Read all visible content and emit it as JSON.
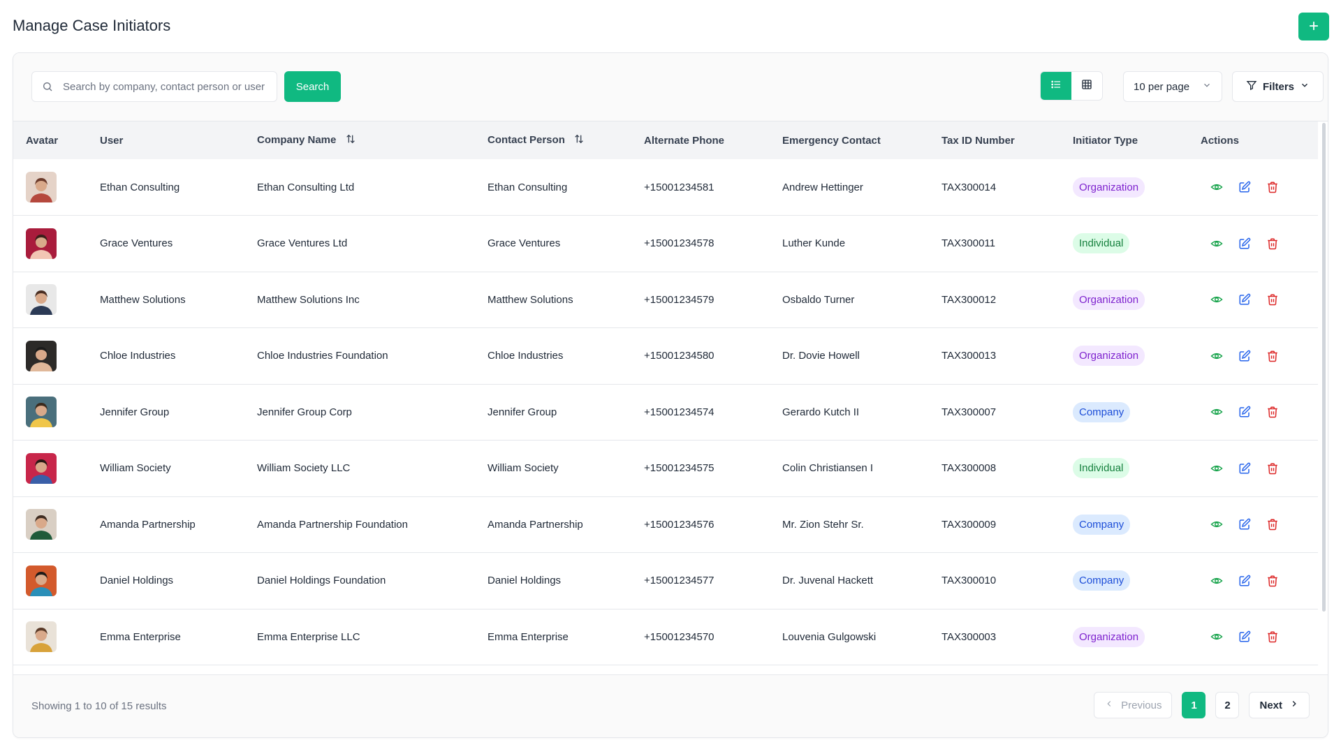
{
  "page": {
    "title": "Manage Case Initiators",
    "add_label": "+"
  },
  "toolbar": {
    "search_placeholder": "Search by company, contact person or user",
    "search_label": "Search",
    "per_page": "10 per page",
    "filters_label": "Filters"
  },
  "table": {
    "headers": {
      "avatar": "Avatar",
      "user": "User",
      "company": "Company Name",
      "contact": "Contact Person",
      "phone": "Alternate Phone",
      "emergency": "Emergency Contact",
      "tax": "Tax ID Number",
      "type": "Initiator Type",
      "actions": "Actions"
    },
    "rows": [
      {
        "user": "Ethan Consulting",
        "company": "Ethan Consulting Ltd",
        "contact": "Ethan Consulting",
        "phone": "+15001234581",
        "emergency": "Andrew Hettinger",
        "tax": "TAX300014",
        "type": "Organization"
      },
      {
        "user": "Grace Ventures",
        "company": "Grace Ventures Ltd",
        "contact": "Grace Ventures",
        "phone": "+15001234578",
        "emergency": "Luther Kunde",
        "tax": "TAX300011",
        "type": "Individual"
      },
      {
        "user": "Matthew Solutions",
        "company": "Matthew Solutions Inc",
        "contact": "Matthew Solutions",
        "phone": "+15001234579",
        "emergency": "Osbaldo Turner",
        "tax": "TAX300012",
        "type": "Organization"
      },
      {
        "user": "Chloe Industries",
        "company": "Chloe Industries Foundation",
        "contact": "Chloe Industries",
        "phone": "+15001234580",
        "emergency": "Dr. Dovie Howell",
        "tax": "TAX300013",
        "type": "Organization"
      },
      {
        "user": "Jennifer Group",
        "company": "Jennifer Group Corp",
        "contact": "Jennifer Group",
        "phone": "+15001234574",
        "emergency": "Gerardo Kutch II",
        "tax": "TAX300007",
        "type": "Company"
      },
      {
        "user": "William Society",
        "company": "William Society LLC",
        "contact": "William Society",
        "phone": "+15001234575",
        "emergency": "Colin Christiansen I",
        "tax": "TAX300008",
        "type": "Individual"
      },
      {
        "user": "Amanda Partnership",
        "company": "Amanda Partnership Foundation",
        "contact": "Amanda Partnership",
        "phone": "+15001234576",
        "emergency": "Mr. Zion Stehr Sr.",
        "tax": "TAX300009",
        "type": "Company"
      },
      {
        "user": "Daniel Holdings",
        "company": "Daniel Holdings Foundation",
        "contact": "Daniel Holdings",
        "phone": "+15001234577",
        "emergency": "Dr. Juvenal Hackett",
        "tax": "TAX300010",
        "type": "Company"
      },
      {
        "user": "Emma Enterprise",
        "company": "Emma Enterprise LLC",
        "contact": "Emma Enterprise",
        "phone": "+15001234570",
        "emergency": "Louvenia Gulgowski",
        "tax": "TAX300003",
        "type": "Organization"
      }
    ]
  },
  "footer": {
    "results": "Showing 1 to 10 of 15 results",
    "previous": "Previous",
    "next": "Next",
    "pages": [
      "1",
      "2"
    ]
  },
  "colors": {
    "accent": "#10b981",
    "organization_bg": "#f3e8ff",
    "organization_fg": "#7e22ce",
    "individual_bg": "#dcfce7",
    "individual_fg": "#15803d",
    "company_bg": "#dbeafe",
    "company_fg": "#1d4ed8",
    "view_icon": "#16a34a",
    "edit_icon": "#2563eb",
    "delete_icon": "#dc2626"
  },
  "icons": {
    "search": "search-icon",
    "list": "list-icon",
    "grid": "grid-icon",
    "chevron": "chevron-down-icon",
    "filter": "filter-icon",
    "sort": "sort-icon",
    "view": "eye-icon",
    "edit": "edit-icon",
    "delete": "trash-icon"
  }
}
